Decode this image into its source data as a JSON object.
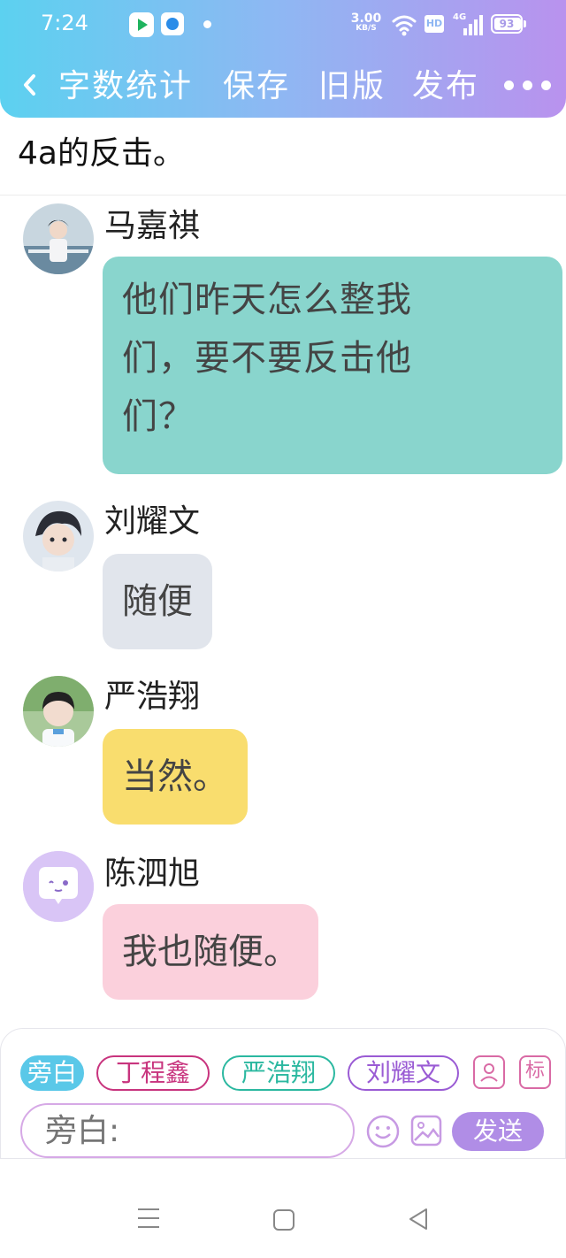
{
  "status_bar": {
    "time": "7:24",
    "net_speed_value": "3.00",
    "net_speed_unit": "KB/S",
    "hd_label": "HD",
    "signal_label": "4G",
    "battery_level": "93"
  },
  "nav": {
    "back_icon": "chevron-left-icon",
    "word_count": "字数统计",
    "save": "保存",
    "old_version": "旧版",
    "publish": "发布",
    "more_icon": "more-dots-icon"
  },
  "content": {
    "partial_text": "4a的反击。"
  },
  "messages": [
    {
      "speaker": "马嘉祺",
      "text": "他们昨天怎么整我们，要不要反击他们？",
      "line1": "他们昨天怎么整我",
      "line2": "们，要不要反击他",
      "line3": "们？",
      "bubble_color": "#89d5cd"
    },
    {
      "speaker": "刘耀文",
      "text": "随便",
      "bubble_color": "#e1e5ec"
    },
    {
      "speaker": "严浩翔",
      "text": "当然。",
      "bubble_color": "#f9dd6e"
    },
    {
      "speaker": "陈泗旭",
      "text": "我也随便。",
      "bubble_color": "#fbd0dc"
    }
  ],
  "input_panel": {
    "roles": [
      "旁白",
      "丁程鑫",
      "严浩翔",
      "刘耀文"
    ],
    "mark_label": "标",
    "input_placeholder": "旁白:",
    "send_label": "发送",
    "emoji_icon": "emoji-icon",
    "image_icon": "image-icon",
    "role_icon": "role-card-icon"
  },
  "system_nav": {
    "menu_icon": "menu-icon",
    "home_icon": "home-square-icon",
    "back_icon": "back-triangle-icon"
  }
}
